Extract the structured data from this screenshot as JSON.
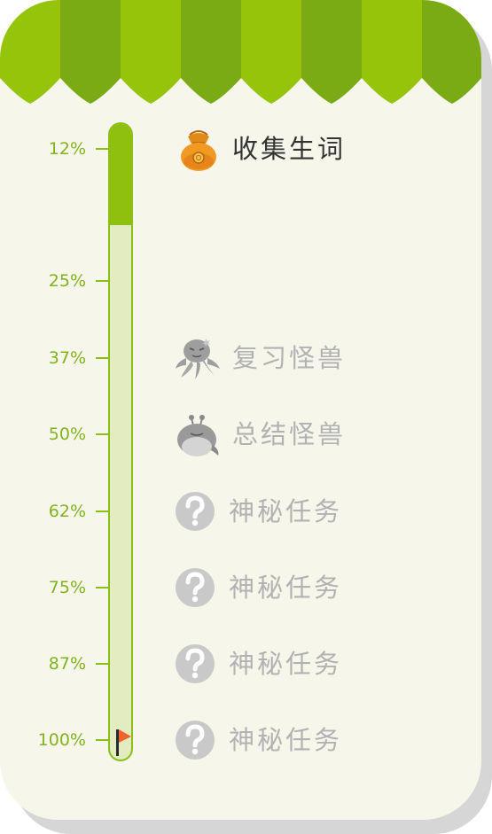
{
  "progress": {
    "value_percent": 12,
    "milestones": [
      {
        "label": "12%"
      },
      {
        "label": "25%"
      },
      {
        "label": "37%"
      },
      {
        "label": "50%"
      },
      {
        "label": "62%"
      },
      {
        "label": "75%"
      },
      {
        "label": "87%"
      },
      {
        "label": "100%"
      }
    ]
  },
  "tasks": [
    {
      "label": "收集生词",
      "icon": "money-bag-icon",
      "state": "active"
    },
    {
      "label": "复习怪兽",
      "icon": "octopus-monster-icon",
      "state": "locked"
    },
    {
      "label": "总结怪兽",
      "icon": "slug-monster-icon",
      "state": "locked"
    },
    {
      "label": "神秘任务",
      "icon": "question-mark-icon",
      "state": "locked"
    },
    {
      "label": "神秘任务",
      "icon": "question-mark-icon",
      "state": "locked"
    },
    {
      "label": "神秘任务",
      "icon": "question-mark-icon",
      "state": "locked"
    },
    {
      "label": "神秘任务",
      "icon": "question-mark-icon",
      "state": "locked"
    }
  ],
  "colors": {
    "awning_light": "#95c40a",
    "awning_dark": "#7aaa14",
    "card_background": "#f6f7ea",
    "progress_fill": "#8fc010",
    "progress_track": "#e2ecc0",
    "percent_text": "#83b221",
    "active_text": "#333333",
    "locked_text": "#b2b2b2",
    "flag": "#f0642c"
  }
}
